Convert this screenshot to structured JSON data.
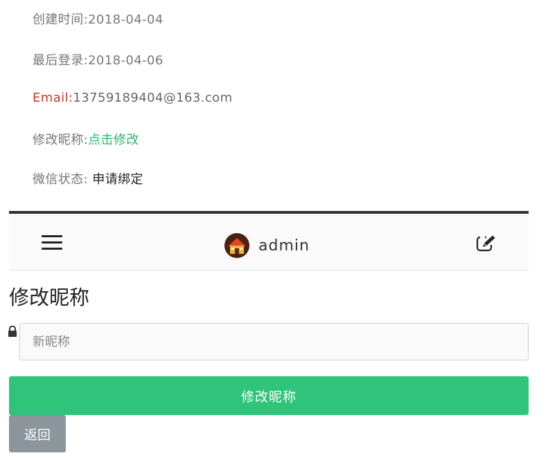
{
  "profile": {
    "created_label": "创建时间:",
    "created_value": "2018-04-04",
    "last_login_label": "最后登录:",
    "last_login_value": "2018-04-06",
    "email_label": "Email:",
    "email_value": "13759189404@163.com",
    "nickname_label": "修改昵称:",
    "nickname_link": "点击修改",
    "wechat_label": "微信状态: ",
    "wechat_link": "申请绑定"
  },
  "topbar": {
    "menu_icon": "hamburger-menu-icon",
    "avatar_icon": "house-avatar-icon",
    "username": "admin",
    "edit_icon": "edit-pencil-icon"
  },
  "form": {
    "title": "修改昵称",
    "lock_icon": "lock-icon",
    "input_placeholder": "新昵称",
    "input_value": "",
    "submit_label": "修改昵称",
    "back_label": "返回"
  },
  "colors": {
    "accent_green": "#2fc47a",
    "link_green": "#2bb673",
    "email_red": "#c0392b",
    "back_gray": "#8c949c"
  }
}
